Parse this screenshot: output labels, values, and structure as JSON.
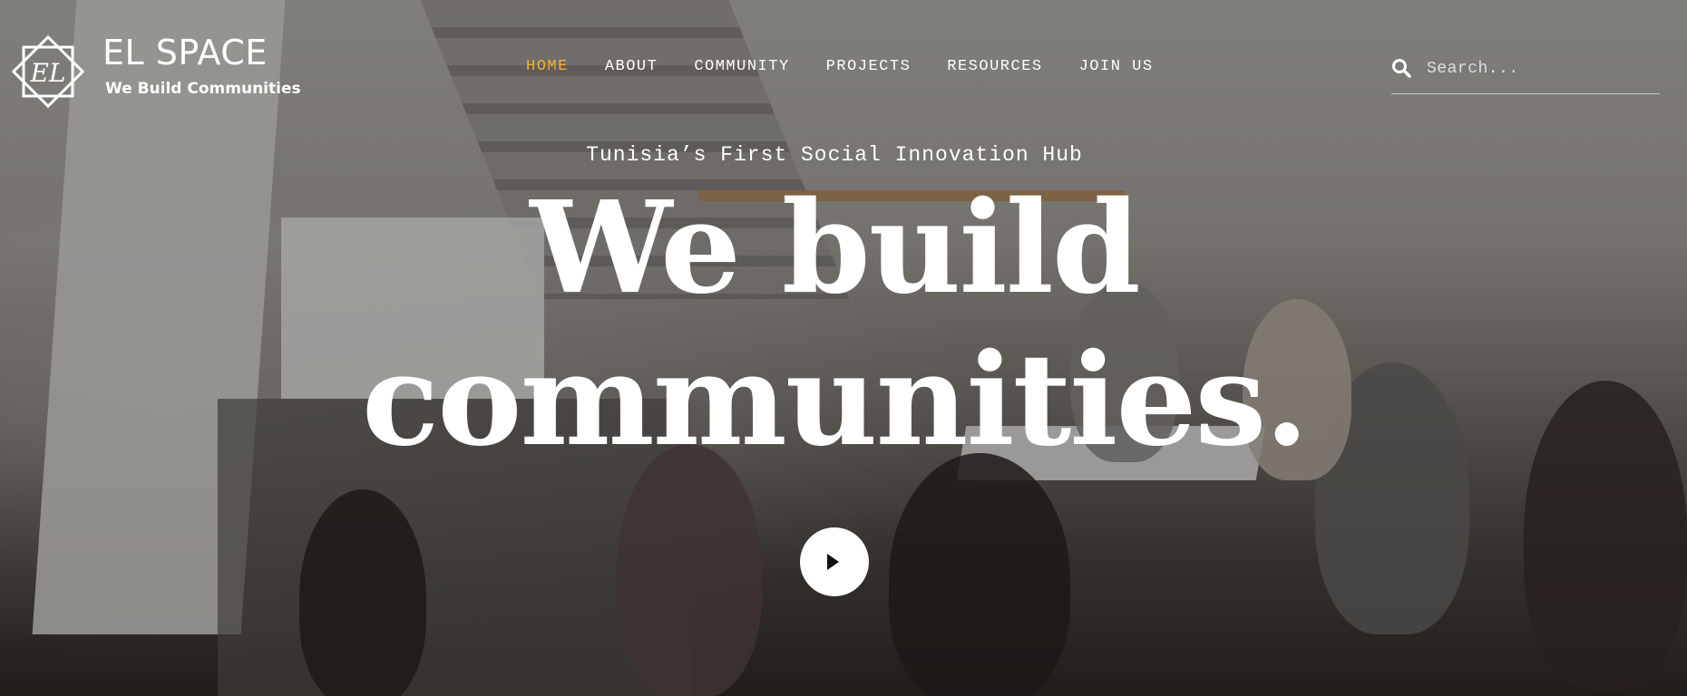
{
  "brand": {
    "name": "EL SPACE",
    "tagline": "We Build Communities",
    "mark_text": "EL"
  },
  "nav": {
    "items": [
      {
        "label": "HOME",
        "active": true
      },
      {
        "label": "ABOUT",
        "active": false
      },
      {
        "label": "COMMUNITY",
        "active": false
      },
      {
        "label": "PROJECTS",
        "active": false
      },
      {
        "label": "RESOURCES",
        "active": false
      },
      {
        "label": "JOIN US",
        "active": false
      }
    ],
    "active_color": "#f2b233"
  },
  "search": {
    "placeholder": "Search...",
    "icon": "search-icon"
  },
  "hero": {
    "kicker": "Tunisia’s First Social Innovation Hub",
    "headline_line1": "We build",
    "headline_line2": "communities.",
    "play_icon": "play-icon"
  }
}
